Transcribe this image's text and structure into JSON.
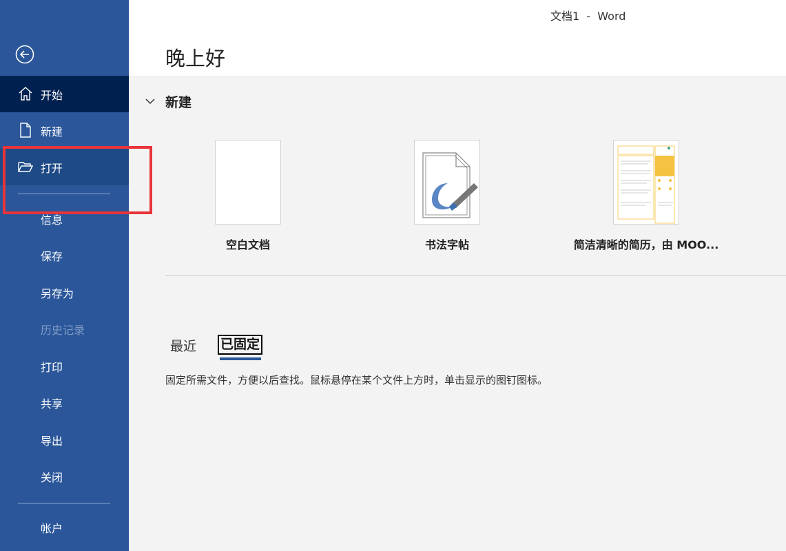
{
  "window": {
    "title": "文档1  -  Word"
  },
  "sidebar": {
    "items": [
      {
        "label": "开始",
        "icon": "home-icon"
      },
      {
        "label": "新建",
        "icon": "new-document-icon"
      },
      {
        "label": "打开",
        "icon": "open-folder-icon"
      },
      {
        "label": "信息"
      },
      {
        "label": "保存"
      },
      {
        "label": "另存为"
      },
      {
        "label": "历史记录"
      },
      {
        "label": "打印"
      },
      {
        "label": "共享"
      },
      {
        "label": "导出"
      },
      {
        "label": "关闭"
      },
      {
        "label": "帐户"
      }
    ],
    "back_icon": "back-arrow-icon"
  },
  "main": {
    "greeting": "晚上好",
    "new_section": {
      "title": "新建",
      "templates": [
        {
          "name": "空白文档"
        },
        {
          "name": "书法字帖"
        },
        {
          "name": "简洁清晰的简历，由 MOO..."
        }
      ]
    },
    "tabs": [
      {
        "label": "最近"
      },
      {
        "label": "已固定"
      }
    ],
    "pinned_hint": "固定所需文件，方便以后查找。鼠标悬停在某个文件上方时，单击显示的图钉图标。"
  },
  "colors": {
    "sidebar": "#2b579a",
    "active": "#002050",
    "highlight": "#e8343a"
  }
}
